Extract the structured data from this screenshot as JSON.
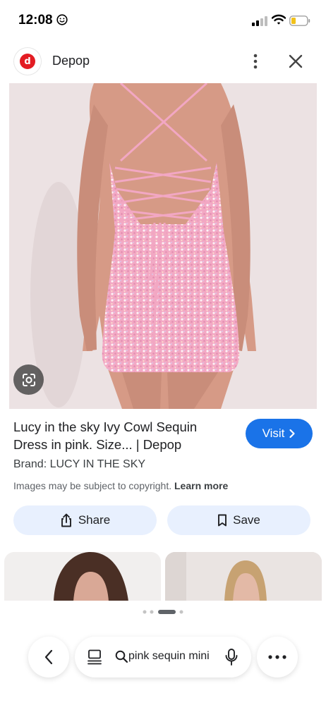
{
  "status_bar": {
    "time": "12:08",
    "icons": [
      "smiley-icon",
      "signal-icon",
      "wifi-icon",
      "battery-icon"
    ]
  },
  "header": {
    "source_logo_letter": "d",
    "source_name": "Depop",
    "more_icon": "more-vertical-icon",
    "close_icon": "close-icon"
  },
  "image": {
    "lens_icon": "google-lens-icon"
  },
  "result": {
    "title": "Lucy in the sky Ivy Cowl Sequin Dress in pink. Size... | Depop",
    "brand": "Brand: LUCY IN THE SKY",
    "copyright_text": "Images may be subject to copyright.",
    "learn_more": "Learn more",
    "visit_label": "Visit",
    "visit_icon": "chevron-right-icon"
  },
  "actions": {
    "share_label": "Share",
    "share_icon": "share-icon",
    "save_label": "Save",
    "save_icon": "bookmark-icon"
  },
  "bottom_nav": {
    "query": "pink sequin mini",
    "back_icon": "chevron-left-icon",
    "tabs_icon": "tabs-icon",
    "search_icon": "search-icon",
    "mic_icon": "mic-icon",
    "menu_icon": "more-horizontal-icon"
  },
  "colors": {
    "accent": "#1a73e8",
    "pill_background": "#e8f0fe",
    "depop_red": "#e31c23",
    "dress_pink": "#f4aec8"
  }
}
